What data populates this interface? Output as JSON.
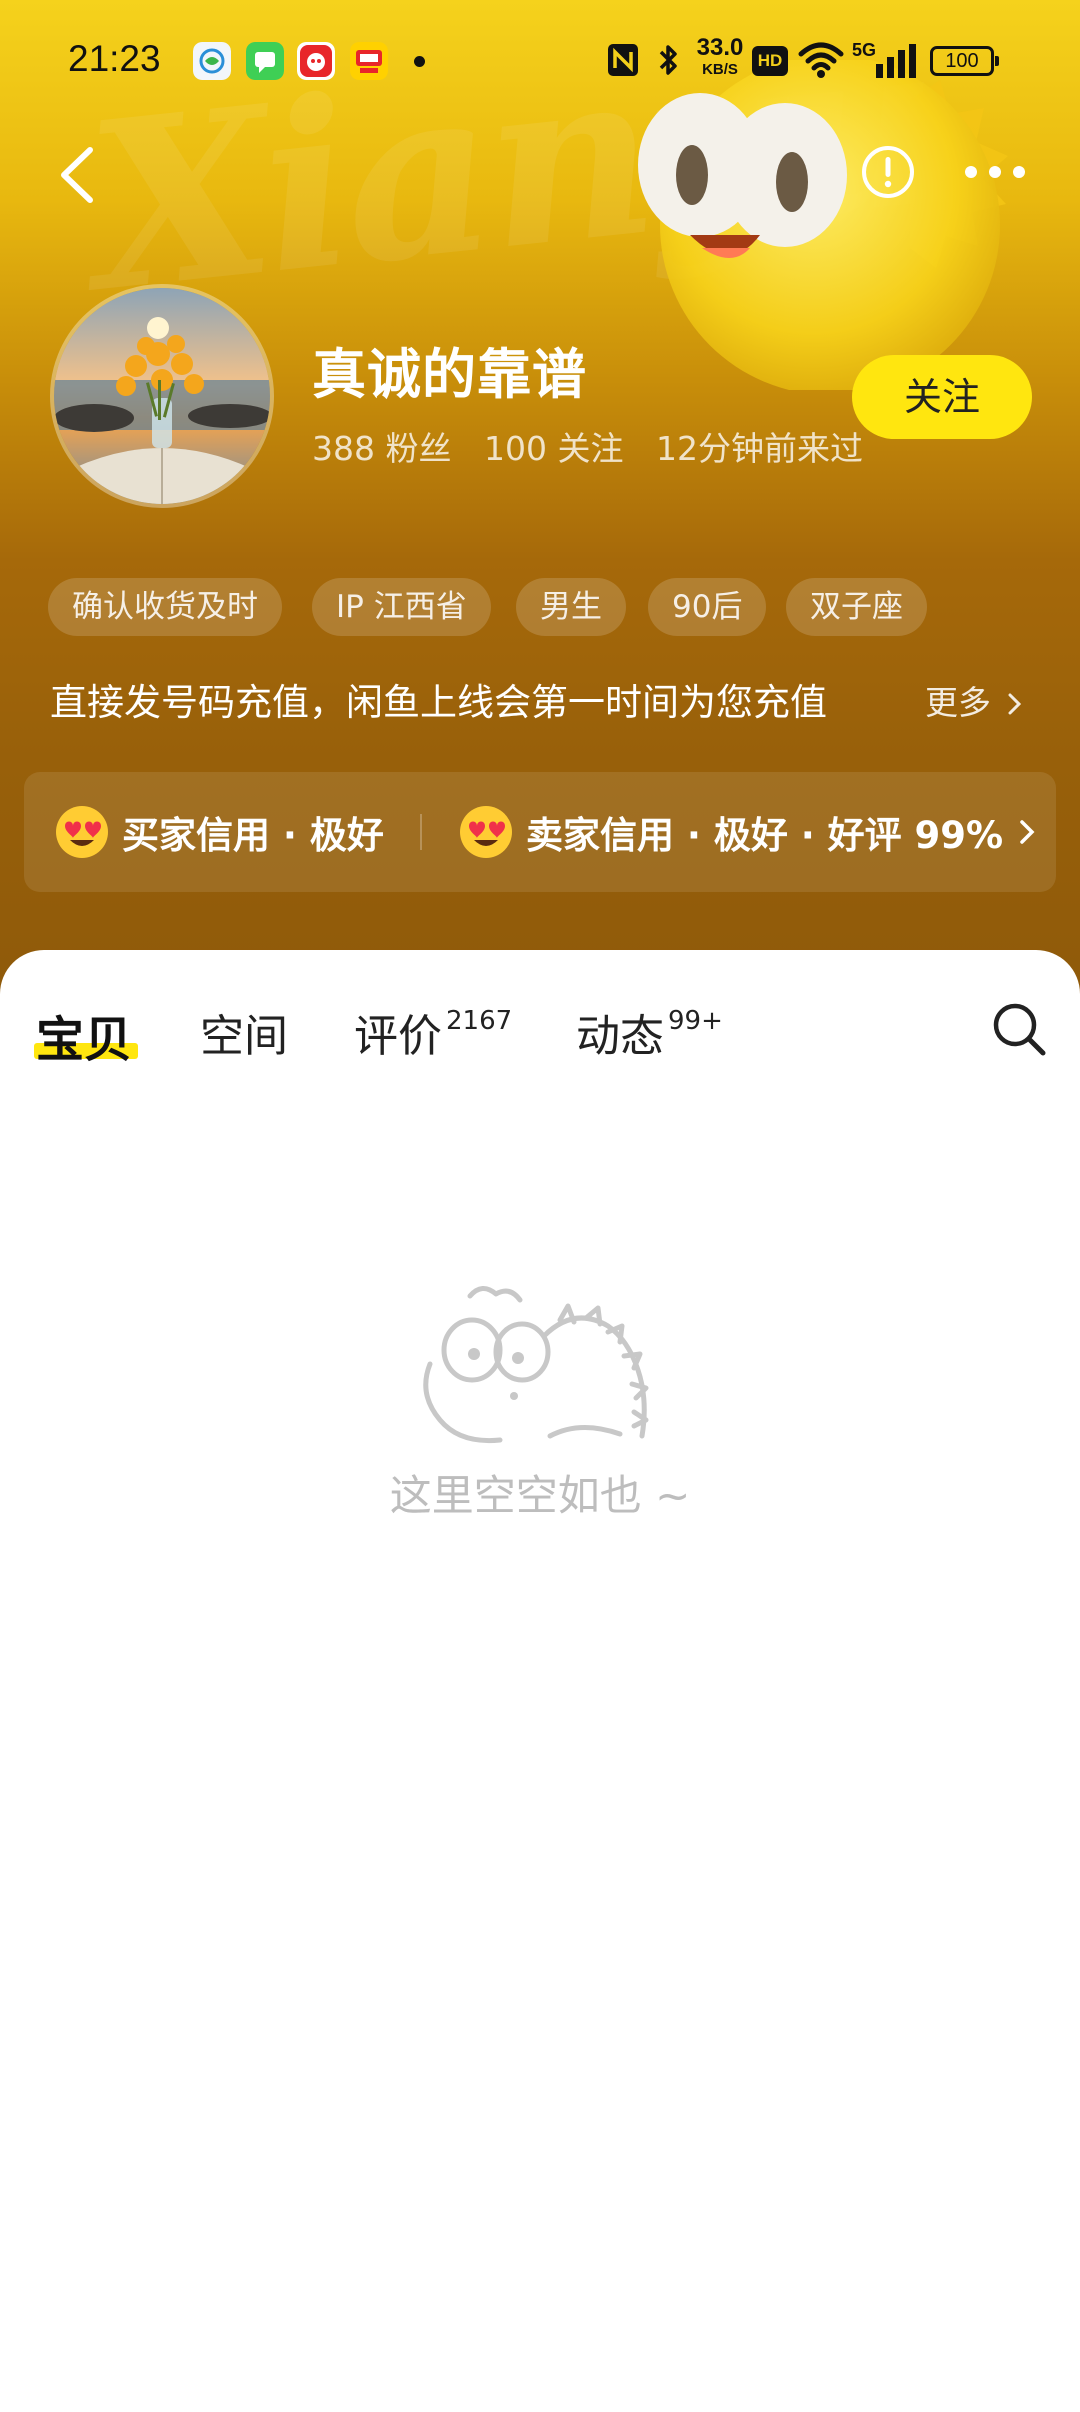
{
  "status_bar": {
    "time": "21:23",
    "net_speed_value": "33.0",
    "net_speed_unit": "KB/S",
    "hd_badge": "HD",
    "signal_label": "5G",
    "battery": "100"
  },
  "nav": {
    "back_icon": "chevron-left-icon",
    "report_icon": "exclamation-circle-icon",
    "more_icon": "more-dots-icon"
  },
  "background": {
    "watermark": "Xianyu"
  },
  "profile": {
    "username": "真诚的靠谱",
    "fans": "388 粉丝",
    "following": "100 关注",
    "last_seen": "12分钟前来过",
    "follow_label": "关注"
  },
  "tags": [
    "确认收货及时",
    "IP 江西省",
    "男生",
    "90后",
    "双子座"
  ],
  "bio": {
    "text": "直接发号码充值，闲鱼上线会第一时间为您充值",
    "more": "更多"
  },
  "credit": {
    "buyer": "买家信用 · 极好",
    "seller": "卖家信用 · 极好 · 好评 99%"
  },
  "tabs": [
    {
      "label": "宝贝",
      "count": ""
    },
    {
      "label": "空间",
      "count": ""
    },
    {
      "label": "评价",
      "count": "2167"
    },
    {
      "label": "动态",
      "count": "99+"
    }
  ],
  "empty": {
    "text": "这里空空如也 ~"
  },
  "colors": {
    "accent": "#ffe60f",
    "header_top": "#f5d21c",
    "header_bottom": "#98600a"
  }
}
